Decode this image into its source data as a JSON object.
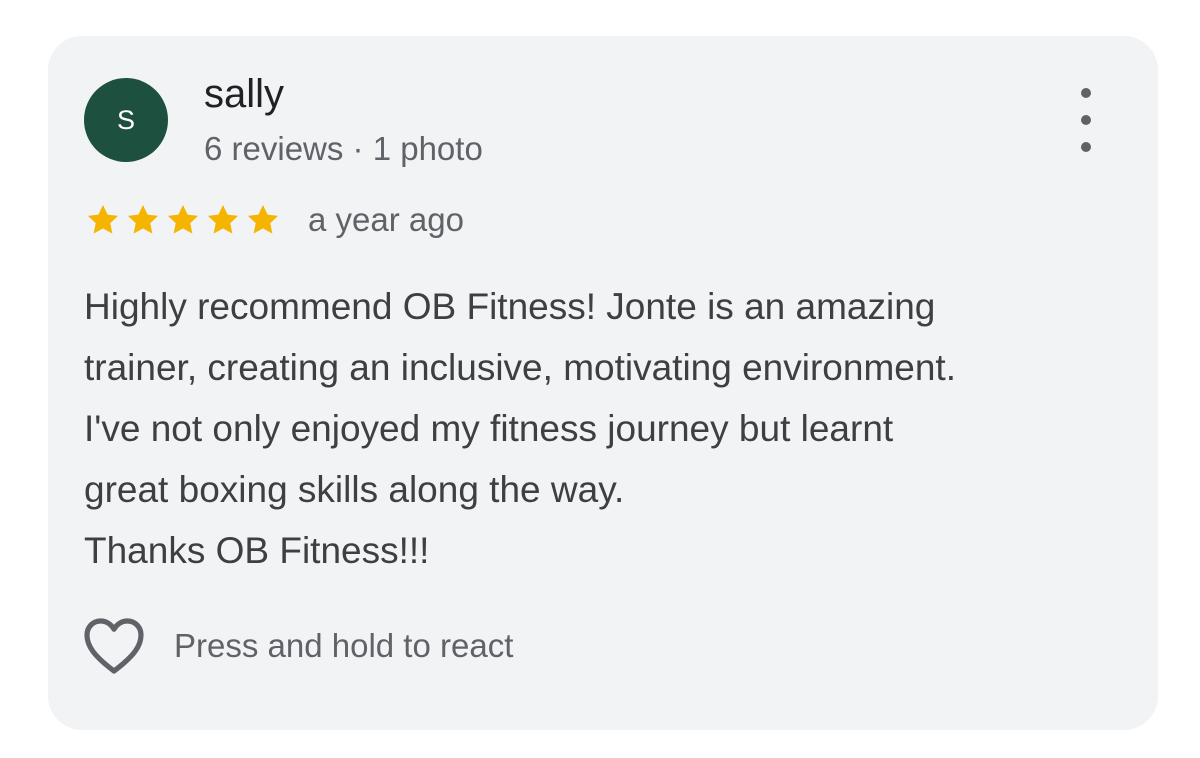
{
  "review": {
    "avatar_initial": "S",
    "avatar_color": "#1e5040",
    "reviewer_name": "sally",
    "reviewer_meta": "6 reviews · 1 photo",
    "rating": 5,
    "rating_max": 5,
    "star_color": "#f4b400",
    "date": "a year ago",
    "text_lines": [
      "Highly recommend OB Fitness! Jonte is an amazing",
      "trainer, creating an inclusive, motivating environment.",
      "I've not only enjoyed my fitness journey but learnt",
      "great boxing skills along the way.",
      "Thanks OB Fitness!!!"
    ],
    "more_options_icon": "more-vert-icon",
    "react_icon": "heart-outline-icon",
    "react_label": "Press and hold to react"
  }
}
